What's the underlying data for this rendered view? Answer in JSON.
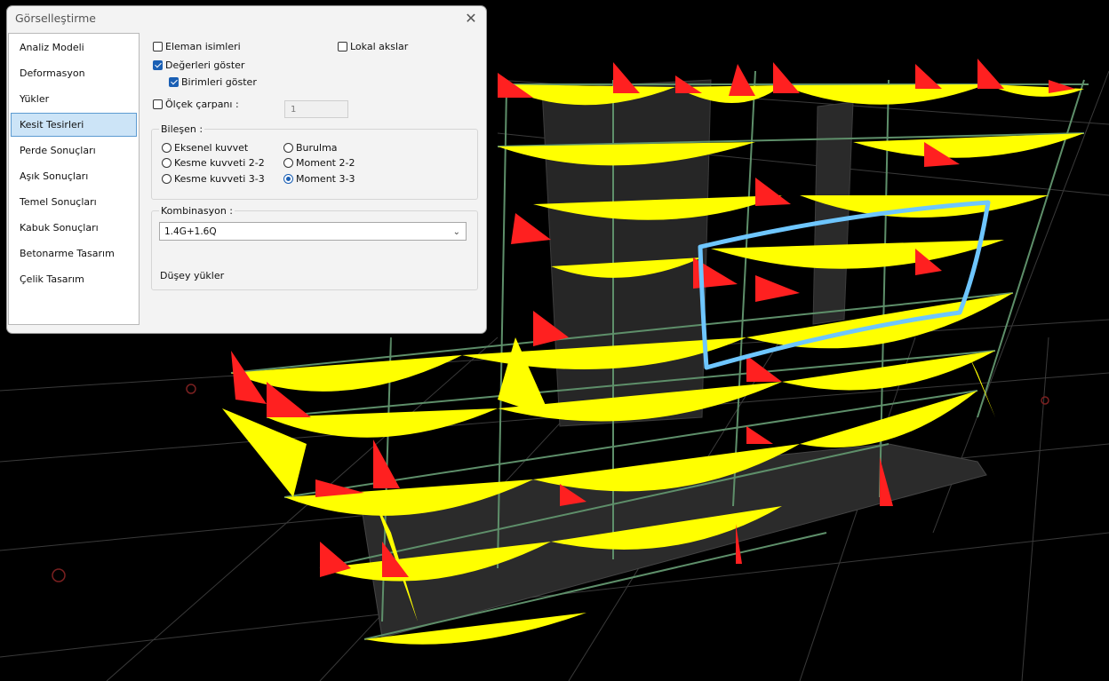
{
  "dialog": {
    "title": "Görselleştirme",
    "close_glyph": "✕",
    "nav_items": [
      {
        "label": "Analiz Modeli",
        "selected": false
      },
      {
        "label": "Deformasyon",
        "selected": false
      },
      {
        "label": "Yükler",
        "selected": false
      },
      {
        "label": "Kesit Tesirleri",
        "selected": true
      },
      {
        "label": "Perde Sonuçları",
        "selected": false
      },
      {
        "label": "Aşık Sonuçları",
        "selected": false
      },
      {
        "label": "Temel Sonuçları",
        "selected": false
      },
      {
        "label": "Kabuk Sonuçları",
        "selected": false
      },
      {
        "label": "Betonarme Tasarım",
        "selected": false
      },
      {
        "label": "Çelik Tasarım",
        "selected": false
      }
    ],
    "options": {
      "element_names": {
        "label": "Eleman isimleri",
        "checked": false
      },
      "local_axes": {
        "label": "Lokal akslar",
        "checked": false
      },
      "show_values": {
        "label": "Değerleri göster",
        "checked": true
      },
      "show_units": {
        "label": "Birimleri göster",
        "checked": true
      },
      "scale_factor": {
        "label": "Ölçek çarpanı :",
        "checked": false,
        "value": "1"
      }
    },
    "component": {
      "label": "Bileşen :",
      "radios": [
        {
          "label": "Eksenel kuvvet",
          "checked": false
        },
        {
          "label": "Kesme kuvveti 2-2",
          "checked": false
        },
        {
          "label": "Kesme kuvveti 3-3",
          "checked": false
        },
        {
          "label": "Burulma",
          "checked": false
        },
        {
          "label": "Moment 2-2",
          "checked": false
        },
        {
          "label": "Moment 3-3",
          "checked": true
        }
      ]
    },
    "combination": {
      "label": "Kombinasyon :",
      "selected": "1.4G+1.6Q",
      "description": "Düşey yükler"
    }
  },
  "colors": {
    "background": "#000000",
    "grid": "#3a3a3a",
    "mesh": "#2b2b2b",
    "frame": "#5e8f6a",
    "moment_positive": "#ffff00",
    "moment_negative": "#ff2020",
    "annotation": "#6ec6ff",
    "accent": "#1a5fb4"
  },
  "icons": {
    "close": "close-icon",
    "dropdown": "chevron-down-icon",
    "selection": "freehand-highlight"
  }
}
